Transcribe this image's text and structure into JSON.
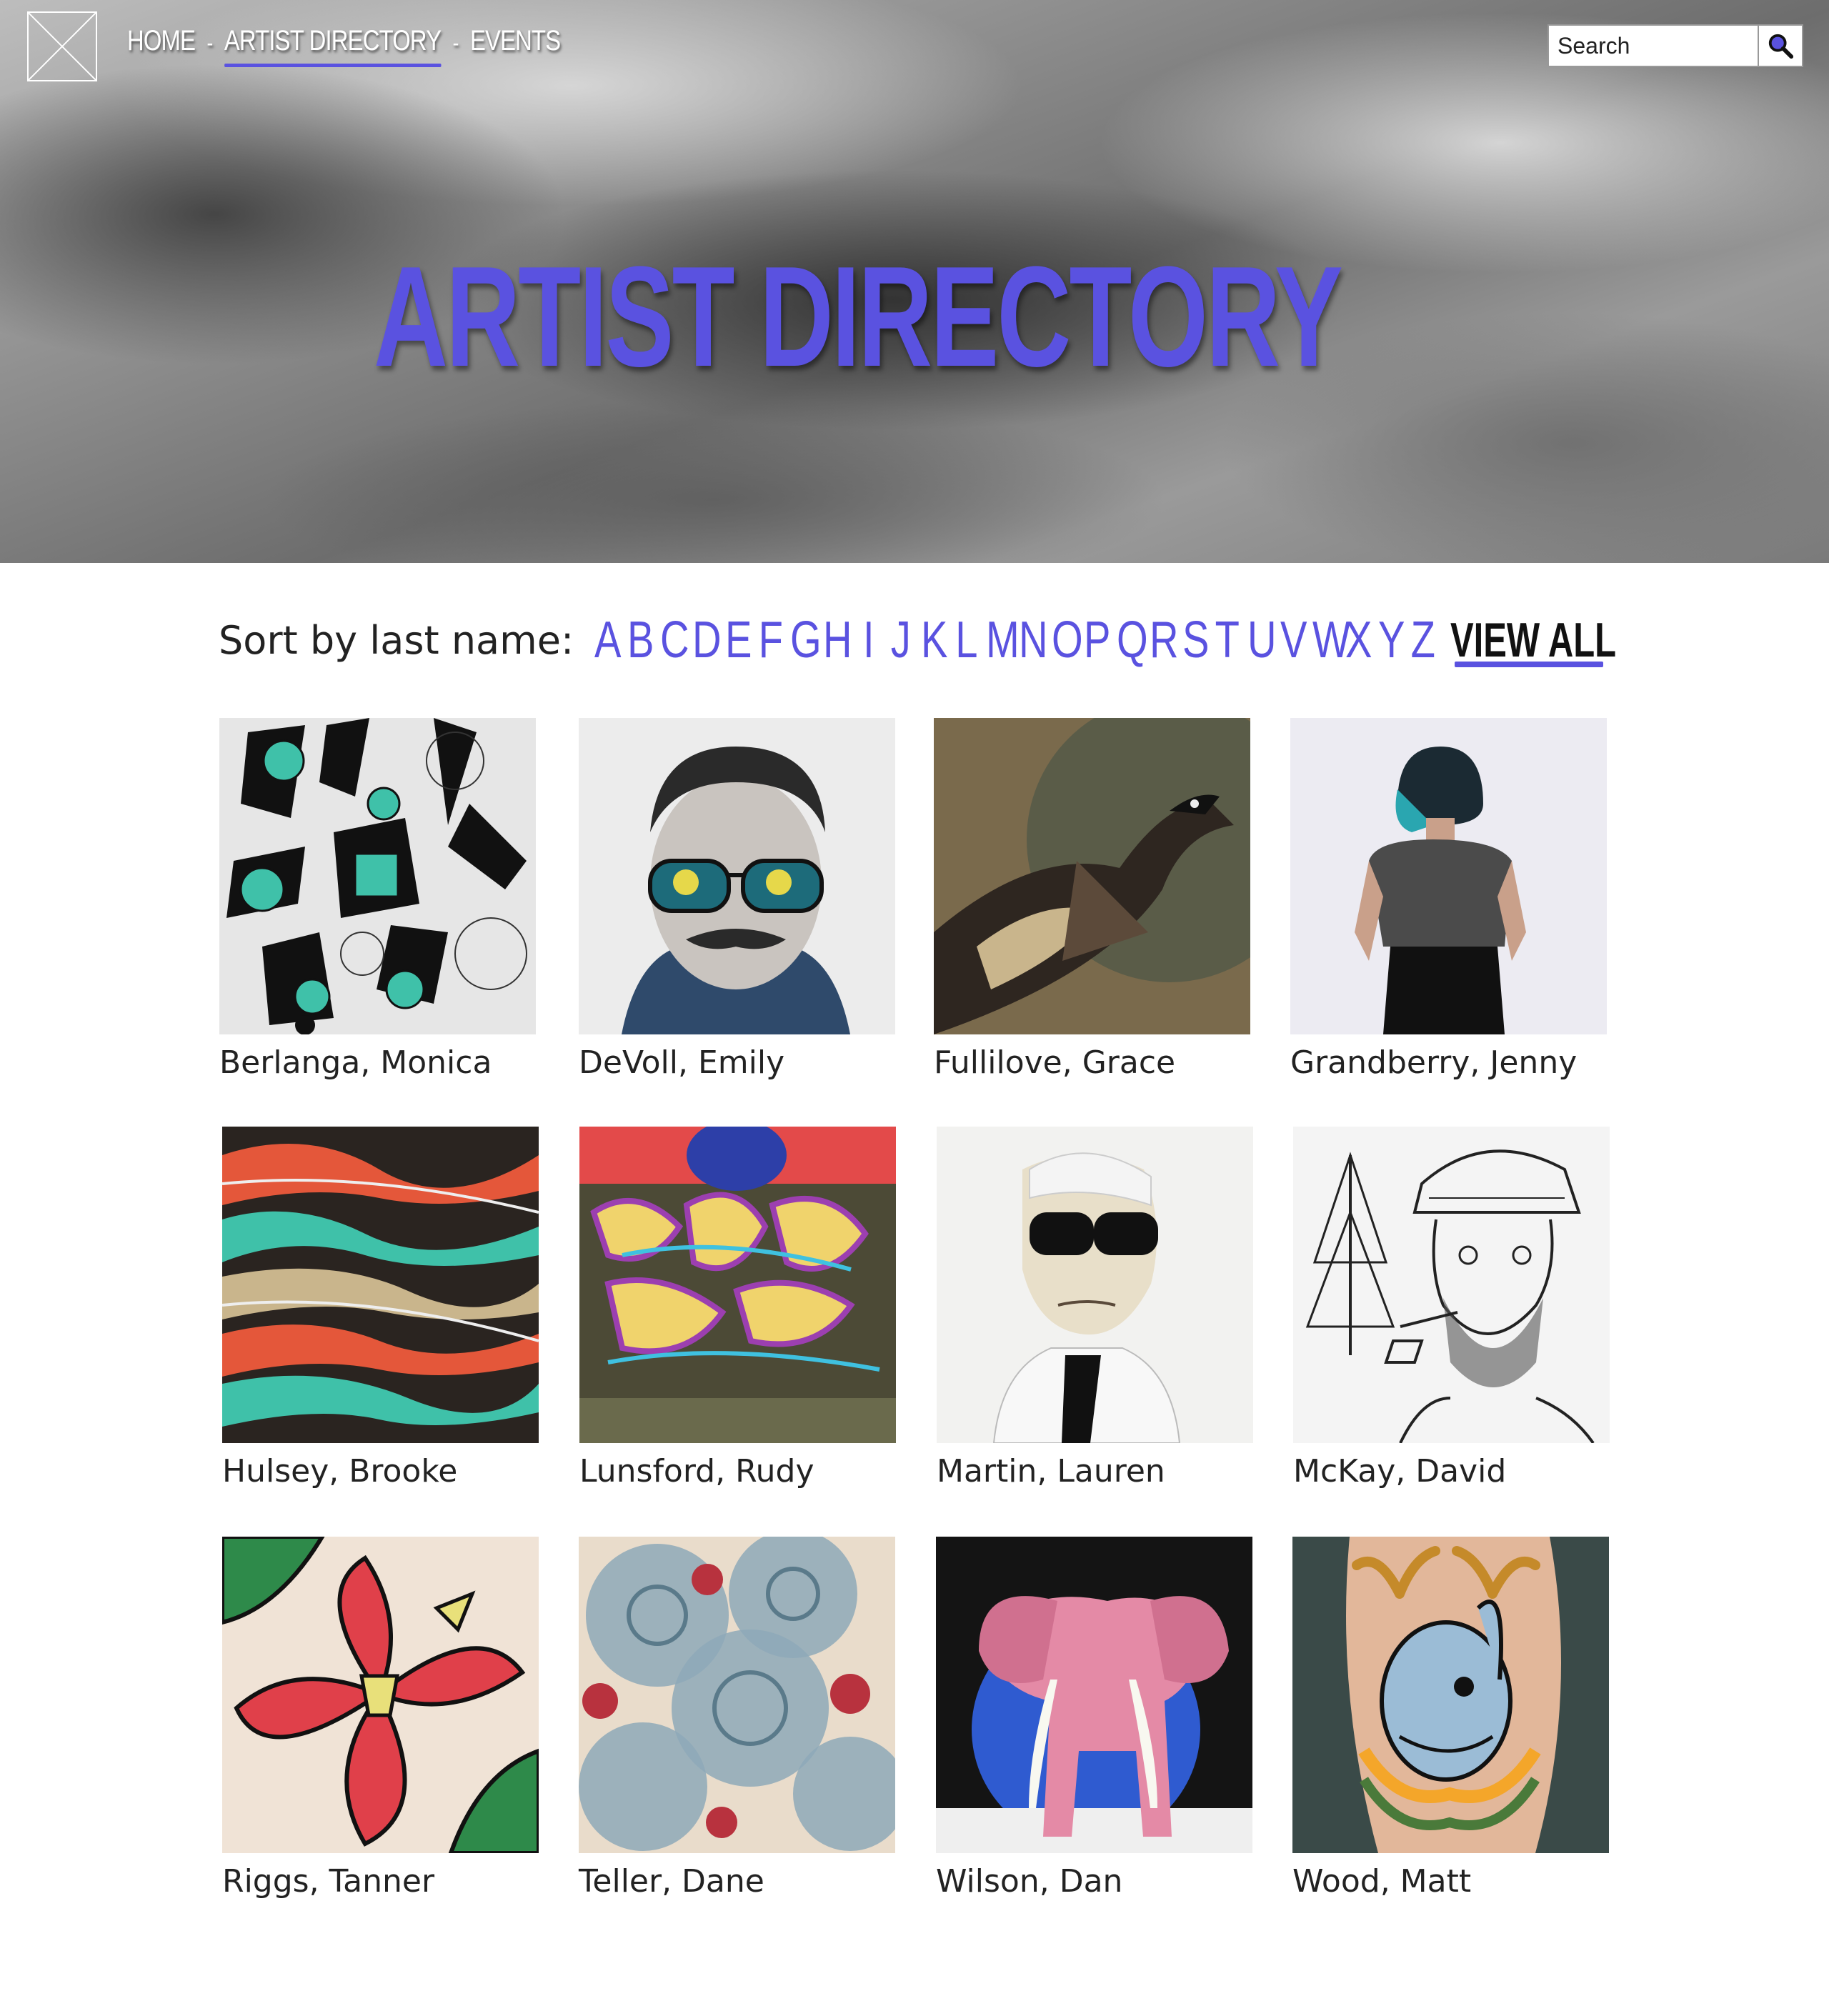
{
  "header": {
    "logo_icon": "logo-placeholder-icon",
    "nav": [
      {
        "label": "HOME",
        "active": false
      },
      {
        "label": "ARTIST DIRECTORY",
        "active": true
      },
      {
        "label": "EVENTS",
        "active": false
      }
    ],
    "nav_separator": "-",
    "search": {
      "placeholder": "Search",
      "value": "",
      "icon": "search-icon"
    }
  },
  "hero": {
    "title": "ARTIST DIRECTORY"
  },
  "sort": {
    "label": "Sort by last name:",
    "letters": [
      "A",
      "B",
      "C",
      "D",
      "E",
      "F",
      "G",
      "H",
      "I",
      "J",
      "K",
      "L",
      "M",
      "N",
      "O",
      "P",
      "Q",
      "R",
      "S",
      "T",
      "U",
      "V",
      "W",
      "X",
      "Y",
      "Z"
    ],
    "view_all": "VIEW ALL"
  },
  "artists": [
    {
      "name": "Berlanga, Monica"
    },
    {
      "name": "DeVoll, Emily"
    },
    {
      "name": "Fullilove, Grace"
    },
    {
      "name": "Grandberry, Jenny"
    },
    {
      "name": "Hulsey, Brooke"
    },
    {
      "name": "Lunsford, Rudy"
    },
    {
      "name": "Martin, Lauren"
    },
    {
      "name": "McKay, David"
    },
    {
      "name": "Riggs, Tanner"
    },
    {
      "name": "Teller, Dane"
    },
    {
      "name": "Wilson, Dan"
    },
    {
      "name": "Wood, Matt"
    }
  ],
  "colors": {
    "accent": "#5a52e0",
    "text": "#222222",
    "background": "#ffffff"
  }
}
